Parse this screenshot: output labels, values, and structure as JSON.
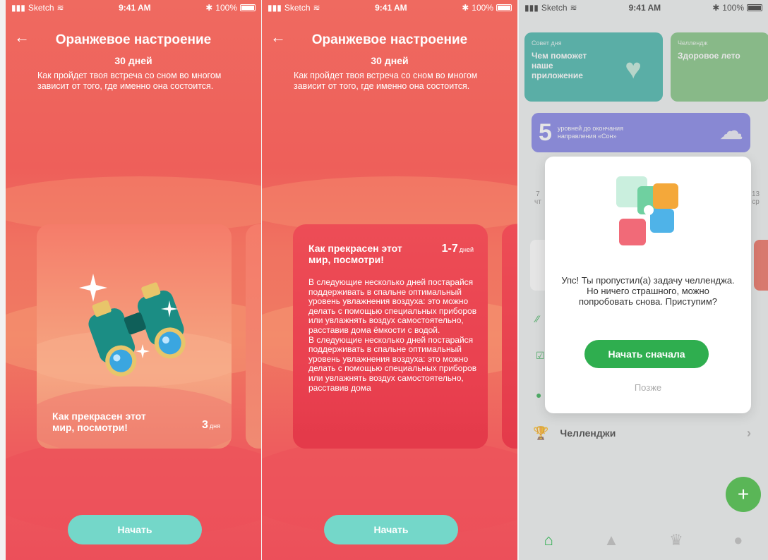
{
  "status": {
    "carrier": "Sketch",
    "time": "9:41 AM",
    "battery": "100%"
  },
  "challenge": {
    "title": "Оранжевое настроение",
    "duration": "30 дней",
    "description": "Как пройдет твоя встреча со сном во многом зависит от того, где именно она состоится."
  },
  "card": {
    "title": "Как прекрасен этот мир, посмотри!",
    "days_num": "3",
    "days_unit": "дня"
  },
  "card_detail": {
    "title": "Как прекрасен этот мир, посмотри!",
    "days_num": "1-7",
    "days_unit": "дней",
    "body": "В следующие несколько дней постарайся поддерживать в спальне оптимальный уровень увлажнения воздуха: это можно делать с помощью специальных приборов или увлажнять воздух самостоятельно, расставив дома ёмкости с водой.\nВ следующие несколько дней постарайся поддерживать в спальне оптимальный уровень увлажнения воздуха: это можно делать с помощью специальных приборов или увлажнять воздух самостоятельно, расставив дома"
  },
  "buttons": {
    "start": "Начать"
  },
  "home": {
    "tile_tip": {
      "label": "Совет дня",
      "title": "Чем поможет наше приложение"
    },
    "tile_challenge": {
      "label": "Челлендж",
      "title": "Здоровое лето"
    },
    "levels": {
      "num": "5",
      "text": "уровней до окончания направления «Сон»"
    },
    "side_left": {
      "num": "7",
      "day": "чт"
    },
    "side_right": {
      "num": "13",
      "day": "ср"
    },
    "challenges_row": "Челленджи"
  },
  "modal": {
    "text": "Упс! Ты пропустил(а) задачу челленджа. Но ничего страшного, можно попробовать снова. Приступим?",
    "primary": "Начать сначала",
    "secondary": "Позже"
  },
  "colors": {
    "accent_green": "#2fae4f",
    "teal": "#74d7c9",
    "coral": "#ef6a60"
  }
}
